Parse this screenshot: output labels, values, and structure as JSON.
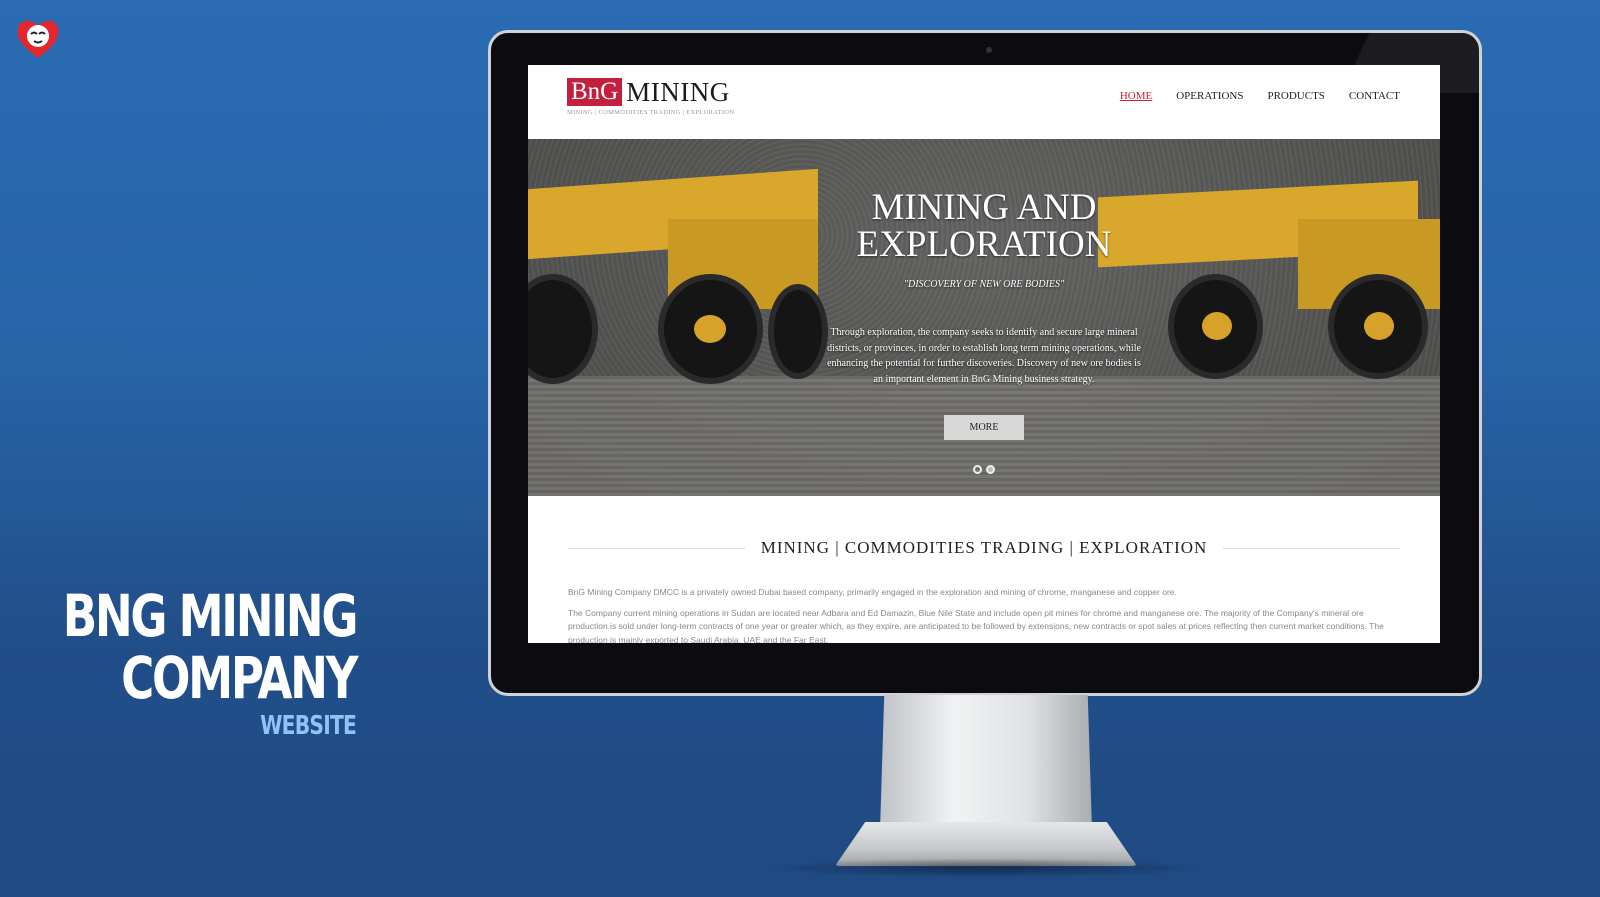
{
  "caption": {
    "title_line1": "BnG Mining",
    "title_line2": "Company",
    "subtitle": "Website"
  },
  "site": {
    "brand_box": "BnG",
    "brand_word": "MINING",
    "brand_tagline": "MINING | COMMODITIES TRADING | EXPLORATION",
    "nav": [
      {
        "label": "HOME",
        "active": true
      },
      {
        "label": "OPERATIONS",
        "active": false
      },
      {
        "label": "PRODUCTS",
        "active": false
      },
      {
        "label": "CONTACT",
        "active": false
      }
    ],
    "hero": {
      "title_line1": "MINING AND",
      "title_line2": "EXPLORATION",
      "tagline": "\"DISCOVERY OF NEW ORE BODIES\"",
      "body": "Through exploration, the company seeks to identify and secure large mineral districts, or provinces, in order to establish long term mining operations, while enhancing the potential for further discoveries. Discovery of new ore bodies is an important element in BnG Mining business strategy.",
      "button": "MORE",
      "slide_count": 2
    },
    "section_heading": "MINING | COMMODITIES TRADING | EXPLORATION",
    "paragraph1": "BnG Mining Company DMCC is a privately owned Dubai based company, primarily engaged in the exploration and mining of chrome, manganese and copper ore.",
    "paragraph2": "The Company current mining operations in Sudan are located near Adbara and Ed Damazin, Blue Nile State and include open pit mines for chrome and manganese ore.   The majority of the Company's mineral ore production is sold under long-term contracts of one year or greater which, as they expire, are anticipated to be followed by extensions, new contracts or spot sales at prices reflecting then current market conditions. The production is mainly exported to Saudi Arabia, UAE and the Far East."
  },
  "colors": {
    "background": "#2a6bb2",
    "brand_red": "#c3203d",
    "caption_sub": "#8fc3f4"
  }
}
